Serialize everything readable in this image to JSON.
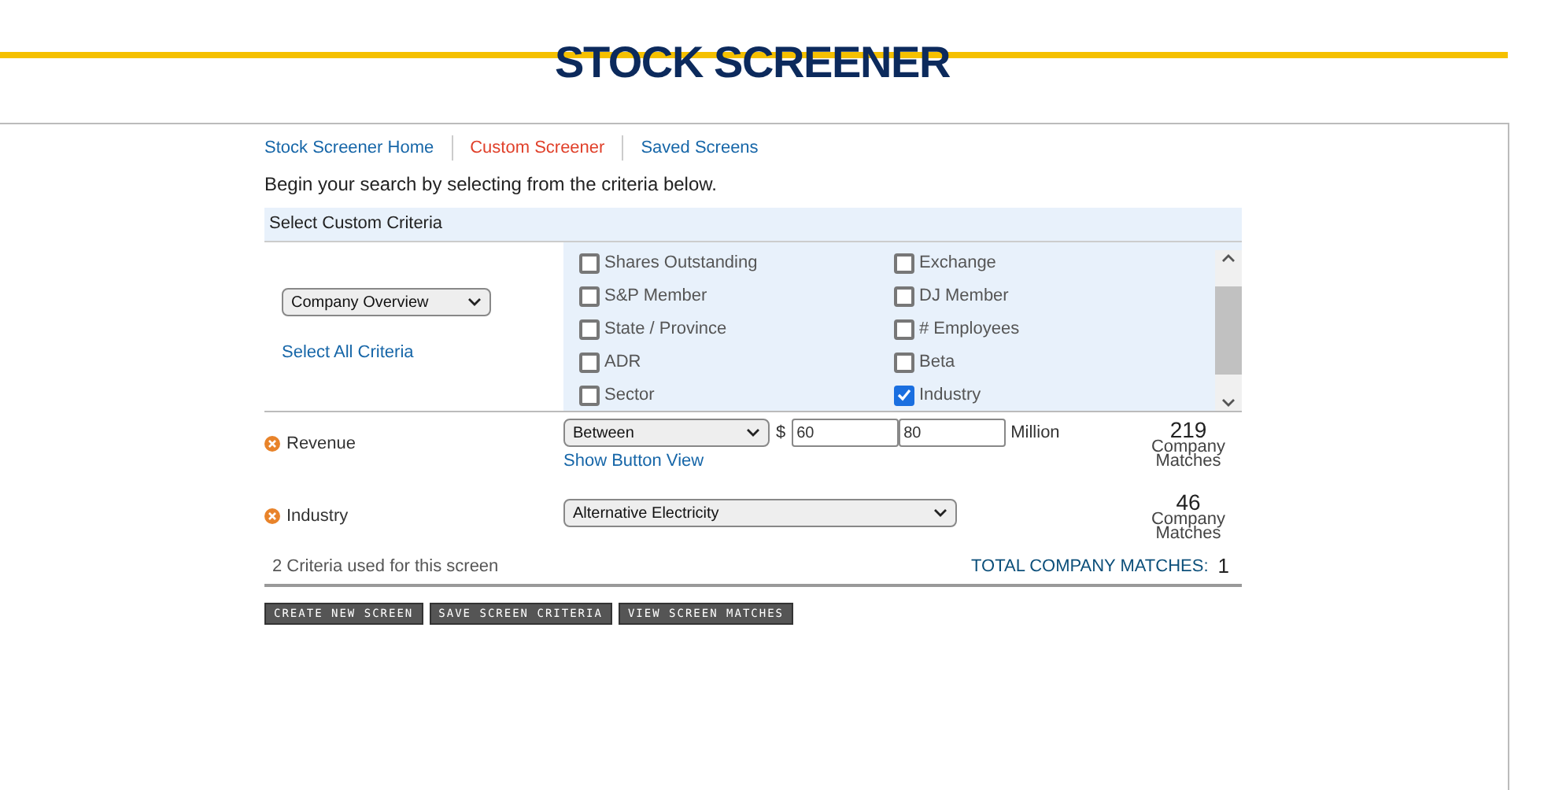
{
  "header": {
    "title": "STOCK SCREENER"
  },
  "nav": [
    {
      "label": "Stock Screener Home",
      "selected": false
    },
    {
      "label": "Custom Screener",
      "selected": true
    },
    {
      "label": "Saved Screens",
      "selected": false
    }
  ],
  "intro": "Begin your search by selecting from the criteria below.",
  "criteria_panel": {
    "title": "Select Custom Criteria",
    "category": "Company Overview",
    "select_all": "Select All Criteria",
    "options": [
      {
        "label": "Shares Outstanding",
        "checked": false
      },
      {
        "label": "S&P Member",
        "checked": false
      },
      {
        "label": "State / Province",
        "checked": false
      },
      {
        "label": "ADR",
        "checked": false
      },
      {
        "label": "Sector",
        "checked": false
      },
      {
        "label": "Exchange",
        "checked": false
      },
      {
        "label": "DJ Member",
        "checked": false
      },
      {
        "label": "# Employees",
        "checked": false
      },
      {
        "label": "Beta",
        "checked": false
      },
      {
        "label": "Industry",
        "checked": true
      }
    ]
  },
  "criteria": [
    {
      "kind": "range",
      "name": "Revenue",
      "operator": "Between",
      "currency": "$",
      "min": "60",
      "max": "80",
      "unit": "Million",
      "link": "Show Button View",
      "count": "219",
      "count_label": "Company Matches"
    },
    {
      "kind": "select",
      "name": "Industry",
      "value": "Alternative Electricity",
      "count": "46",
      "count_label": "Company Matches"
    }
  ],
  "summary": {
    "used": "2 Criteria used for this screen",
    "total_label": "TOTAL COMPANY MATCHES:",
    "total": "1"
  },
  "buttons": [
    "CREATE NEW SCREEN",
    "SAVE SCREEN CRITERIA",
    "VIEW SCREEN MATCHES"
  ]
}
